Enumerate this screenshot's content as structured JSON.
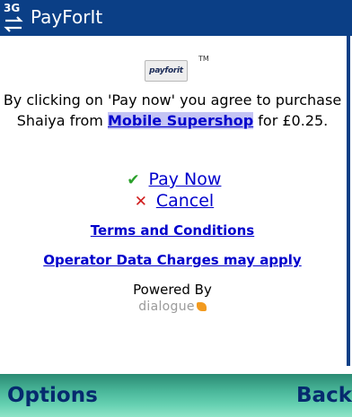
{
  "titlebar": {
    "network": "3G",
    "title": "PayForIt"
  },
  "logo": {
    "text": "payforit",
    "trademark": "TM"
  },
  "consent": {
    "text_before": "By clicking on 'Pay now' you agree to purchase Shaiya from ",
    "merchant": "Mobile Supershop",
    "text_after": " for £0.25."
  },
  "actions": {
    "pay_now": "Pay Now",
    "cancel": "Cancel"
  },
  "links": {
    "terms": "Terms and Conditions",
    "operator_charges": "Operator Data Charges may apply"
  },
  "footer": {
    "powered_by": "Powered By",
    "brand": "dialogue"
  },
  "softkeys": {
    "left": "Options",
    "right": "Back"
  },
  "colors": {
    "titlebar": "#0b3f86",
    "link": "#0000cc",
    "check": "#2aa02a",
    "cross": "#d01c1c",
    "softbar": "#4ab79a",
    "brand_accent": "#f29a1f"
  }
}
